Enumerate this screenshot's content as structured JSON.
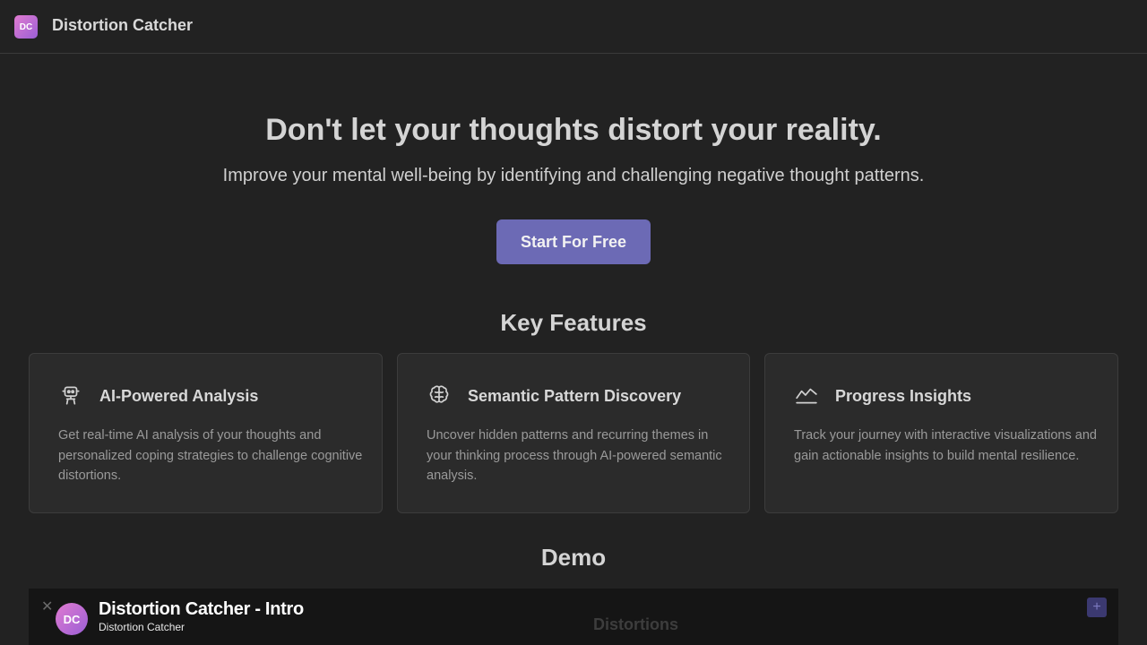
{
  "header": {
    "logo_text": "DC",
    "app_name": "Distortion Catcher"
  },
  "hero": {
    "title": "Don't let your thoughts distort your reality.",
    "subtitle": "Improve your mental well-being by identifying and challenging negative thought patterns.",
    "cta_label": "Start For Free"
  },
  "features": {
    "heading": "Key Features",
    "cards": [
      {
        "icon": "robot-icon",
        "title": "AI-Powered Analysis",
        "description": "Get real-time AI analysis of your thoughts and personalized coping strategies to challenge cognitive distortions."
      },
      {
        "icon": "brain-icon",
        "title": "Semantic Pattern Discovery",
        "description": "Uncover hidden patterns and recurring themes in your thinking process through AI-powered semantic analysis."
      },
      {
        "icon": "chart-line-icon",
        "title": "Progress Insights",
        "description": "Track your journey with interactive visualizations and gain actionable insights to build mental resilience."
      }
    ]
  },
  "demo": {
    "heading": "Demo",
    "video": {
      "avatar_text": "DC",
      "title": "Distortion Catcher - Intro",
      "channel": "Distortion Catcher",
      "background_text": "Distortions",
      "close_glyph": "✕",
      "plus_glyph": "+"
    }
  },
  "colors": {
    "background": "#222222",
    "accent_button": "#6c6ab5",
    "card_background": "#2b2b2b",
    "logo_gradient_start": "#e07bd0",
    "logo_gradient_end": "#9b5fd6"
  }
}
